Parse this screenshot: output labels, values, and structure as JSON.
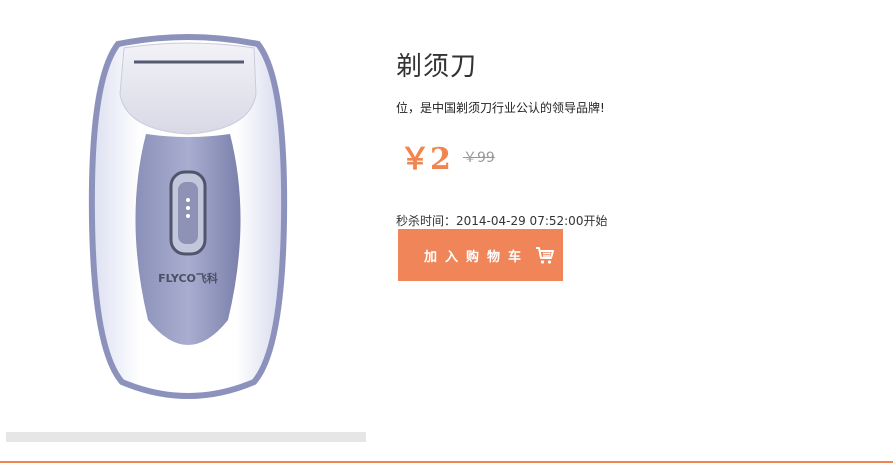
{
  "product": {
    "title": "剃须刀",
    "description": "位，是中国剃须刀行业公认的领导品牌!",
    "price": "￥2",
    "old_price": "￥99",
    "seckill_time": "秒杀时间：2014-04-29 07:52:00开始",
    "image_brand_text": "FLYCO飞科",
    "add_to_cart_label": "加入购物车"
  },
  "icons": {
    "cart": "shopping-cart-icon"
  },
  "colors": {
    "accent": "#f0854f",
    "button": "#f0855a",
    "old_price": "#999999"
  }
}
